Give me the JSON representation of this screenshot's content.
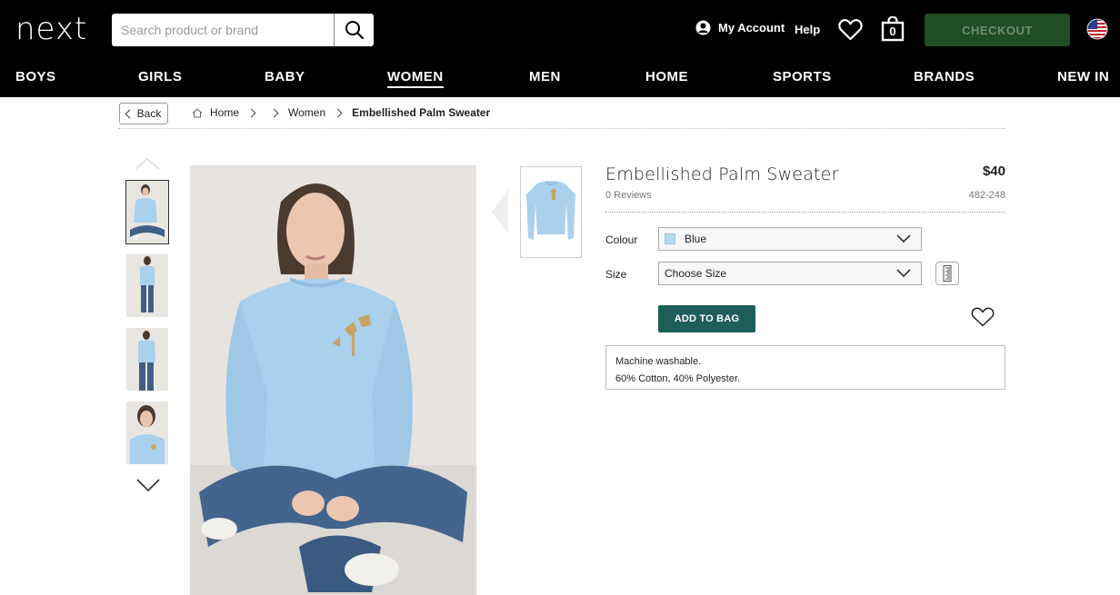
{
  "header": {
    "logo": "next",
    "search_placeholder": "Search product or brand",
    "account_label": "My Account",
    "help_label": "Help",
    "bag_count": "0",
    "checkout_label": "CHECKOUT",
    "nav": [
      "BOYS",
      "GIRLS",
      "BABY",
      "WOMEN",
      "MEN",
      "HOME",
      "SPORTS",
      "BRANDS",
      "NEW IN"
    ],
    "active_nav": "WOMEN"
  },
  "breadcrumb": {
    "back_label": "Back",
    "items": [
      "Home",
      "Women",
      "Embellished Palm Sweater"
    ]
  },
  "product": {
    "title": "Embellished Palm Sweater",
    "reviews": "0 Reviews",
    "price": "$40",
    "code": "482-248",
    "colour_label": "Colour",
    "colour_value": "Blue",
    "colour_hex": "#b7d9ef",
    "size_label": "Size",
    "size_value": "Choose Size",
    "add_to_bag": "ADD TO BAG",
    "care": [
      "Machine washable.",
      "60% Cotton, 40% Polyester."
    ]
  },
  "colors": {
    "header_bg": "#000000",
    "checkout_bg": "#1f4d24",
    "add_to_bag_bg": "#1d5e5a"
  }
}
